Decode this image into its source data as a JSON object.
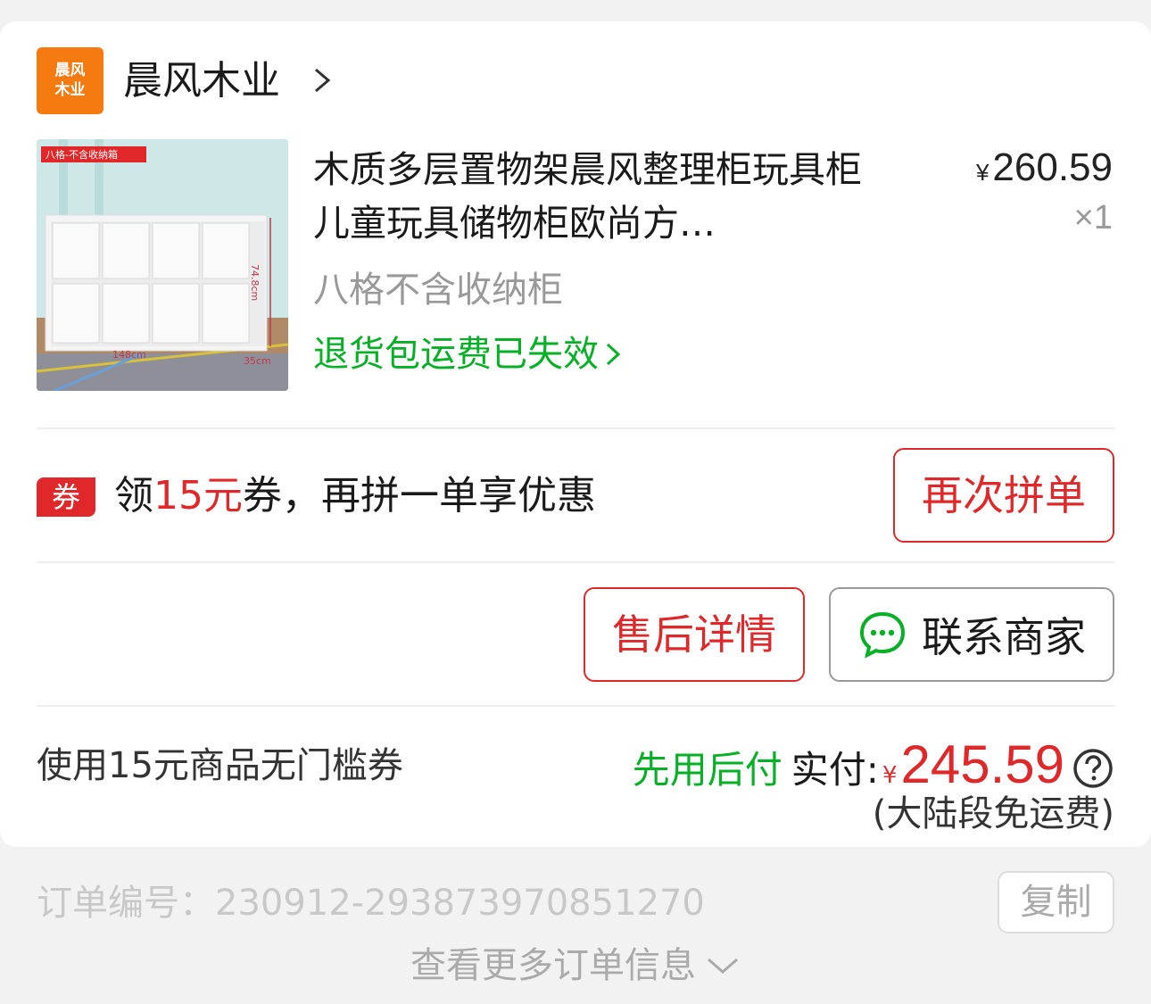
{
  "shop": {
    "logo_text_line1": "晨风",
    "logo_text_line2": "木业",
    "name": "晨风木业"
  },
  "product": {
    "title": "木质多层置物架晨风整理柜玩具柜儿童玩具储物柜欧尚方…",
    "price_symbol": "¥",
    "price": "260.59",
    "quantity": "×1",
    "variant": "八格不含收纳柜",
    "return_shipping": "退货包运费已失效",
    "image": {
      "tag": "八格-不含收纳箱",
      "dim_height": "74.8cm",
      "dim_width": "148cm",
      "dim_depth": "35cm"
    }
  },
  "coupon": {
    "badge": "券",
    "text_prefix": "领",
    "text_amount": "15元",
    "text_suffix": "券，再拼一单享优惠",
    "reorder_button": "再次拼单"
  },
  "actions": {
    "after_sale": "售后详情",
    "contact": "联系商家"
  },
  "summary": {
    "discount_note": "使用15元商品无门槛券",
    "pay_later": "先用后付",
    "actual_label": "实付:",
    "currency": "¥",
    "amount": "245.59",
    "shipping_note": "(大陆段免运费)"
  },
  "order": {
    "number_text": "订单编号：230912-293873970851270",
    "copy_button": "复制",
    "more_info": "查看更多订单信息"
  },
  "colors": {
    "accent_red": "#e0282a",
    "green": "#07b126",
    "logo_orange": "#f57a10"
  }
}
